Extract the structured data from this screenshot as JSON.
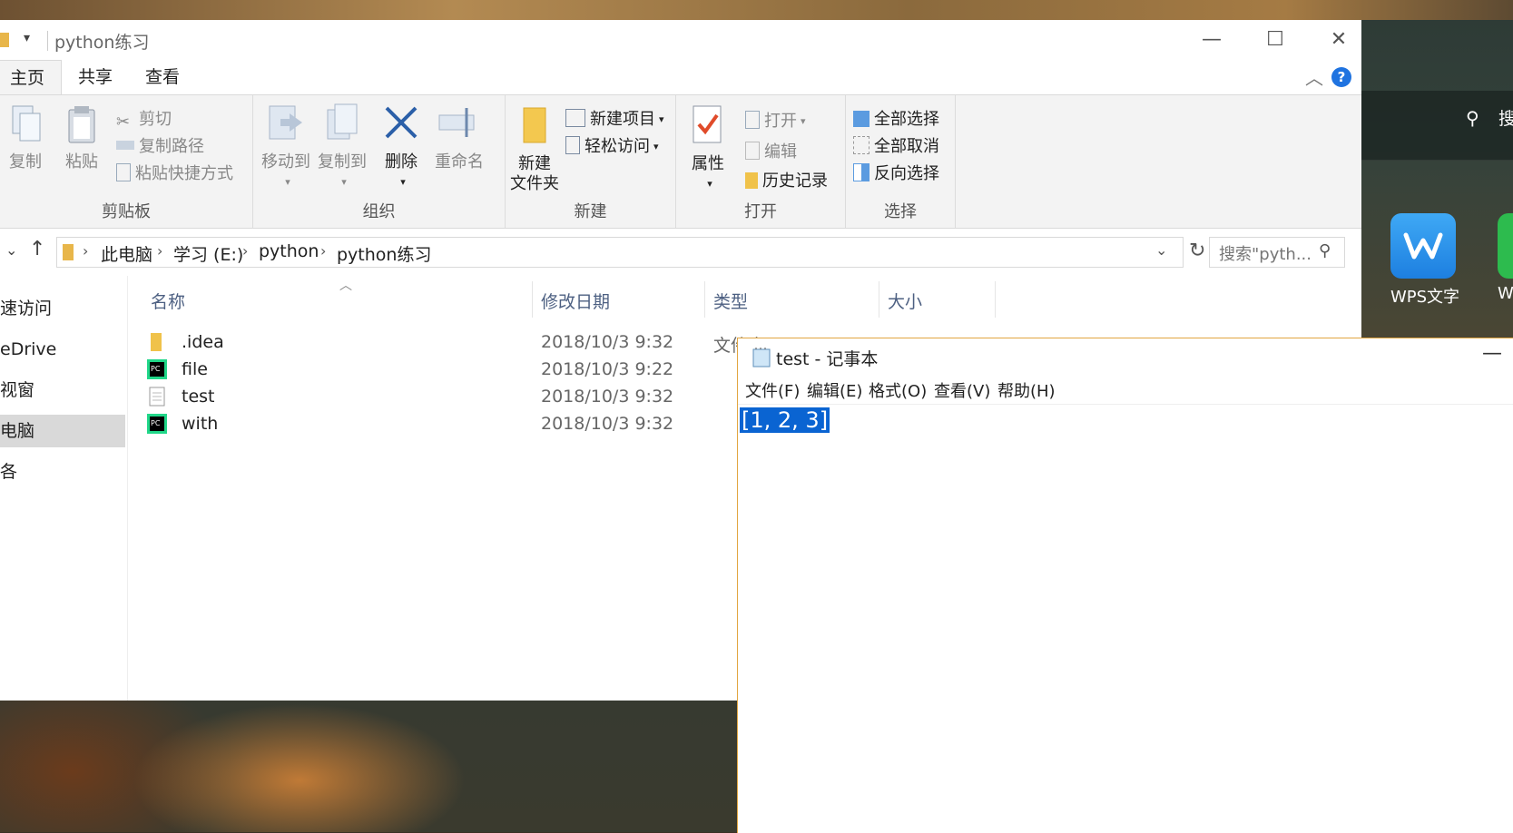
{
  "explorer": {
    "title": "python练习",
    "tabs": [
      "主页",
      "共享",
      "查看"
    ],
    "ribbon": {
      "clipboard": {
        "label": "剪贴板",
        "copy": "复制",
        "paste": "粘贴",
        "cut": "剪切",
        "copy_path": "复制路径",
        "paste_shortcut": "粘贴快捷方式"
      },
      "organize": {
        "label": "组织",
        "move_to": "移动到",
        "copy_to": "复制到",
        "delete": "删除",
        "rename": "重命名"
      },
      "new": {
        "label": "新建",
        "new_folder_1": "新建",
        "new_folder_2": "文件夹",
        "new_item": "新建项目",
        "easy_access": "轻松访问"
      },
      "open": {
        "label": "打开",
        "properties": "属性",
        "open": "打开",
        "edit": "编辑",
        "history": "历史记录"
      },
      "select": {
        "label": "选择",
        "select_all": "全部选择",
        "select_none": "全部取消",
        "invert": "反向选择"
      }
    },
    "address": {
      "crumbs": [
        "此电脑",
        "学习 (E:)",
        "python",
        "python练习"
      ],
      "search_placeholder": "搜索\"pyth..."
    },
    "nav": [
      "速访问",
      "eDrive",
      "视窗",
      "电脑",
      "各"
    ],
    "columns": {
      "name": "名称",
      "modified": "修改日期",
      "type": "类型",
      "size": "大小"
    },
    "files": [
      {
        "name": ".idea",
        "modified": "2018/10/3 9:32",
        "type": "文件夹",
        "icon": "folder-icon"
      },
      {
        "name": "file",
        "modified": "2018/10/3 9:22",
        "type": "",
        "icon": "pycharm-icon"
      },
      {
        "name": "test",
        "modified": "2018/10/3 9:32",
        "type": "",
        "icon": "text-file-icon"
      },
      {
        "name": "with",
        "modified": "2018/10/3 9:32",
        "type": "",
        "icon": "pycharm-icon"
      }
    ]
  },
  "notepad": {
    "title": "test - 记事本",
    "menu": [
      "文件(F)",
      "编辑(E)",
      "格式(O)",
      "查看(V)",
      "帮助(H)"
    ],
    "content": "[1, 2, 3]"
  },
  "desktop": {
    "search_char": "搜",
    "wps_label": "WPS文字",
    "w_label": "W"
  },
  "colors": {
    "accent": "#1f73e0",
    "selection": "#0a64d2",
    "notepad_border": "#e2a641"
  }
}
